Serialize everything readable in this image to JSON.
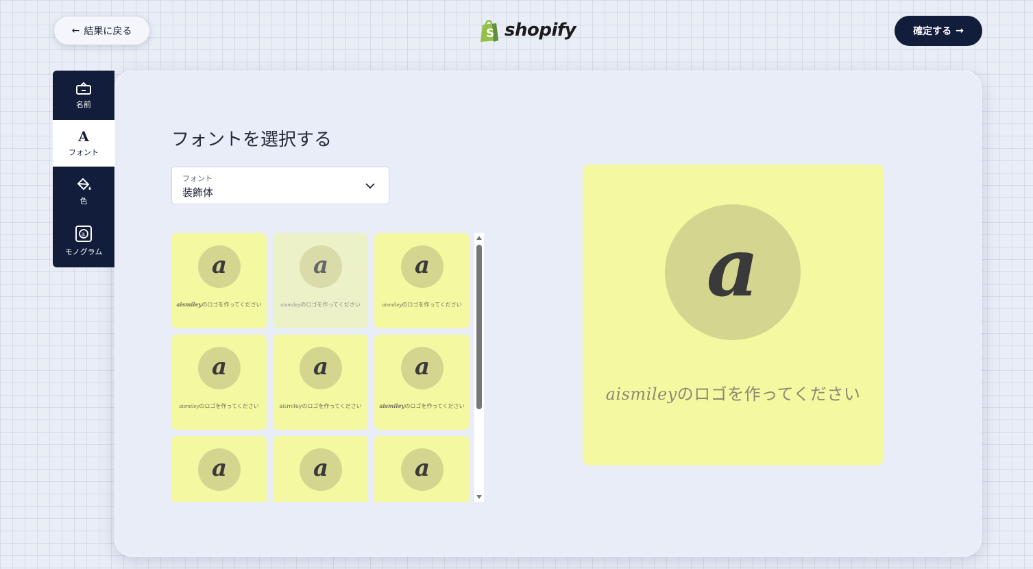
{
  "header": {
    "back_label": "結果に戻る",
    "confirm_label": "確定する",
    "brand": "shopify"
  },
  "sidebar": {
    "items": [
      {
        "label": "名前",
        "icon": "name-tag-icon"
      },
      {
        "label": "フォント",
        "icon": "font-icon",
        "glyph": "A"
      },
      {
        "label": "色",
        "icon": "paint-bucket-icon"
      },
      {
        "label": "モノグラム",
        "icon": "monogram-icon"
      }
    ],
    "active_index": 1
  },
  "main": {
    "title": "フォントを選択する",
    "font_select": {
      "label": "フォント",
      "value": "装飾体"
    },
    "tiles": [
      {
        "letter": "a",
        "brand": "aismiley",
        "caption": "のロゴを作ってください"
      },
      {
        "letter": "a",
        "brand": "aismiley",
        "caption": "のロゴを作ってください"
      },
      {
        "letter": "a",
        "brand": "aismiley",
        "caption": "のロゴを作ってください"
      },
      {
        "letter": "a",
        "brand": "aismiley",
        "caption": "のロゴを作ってください"
      },
      {
        "letter": "a",
        "brand": "aismiley",
        "caption": "のロゴを作ってください"
      },
      {
        "letter": "a",
        "brand": "aismiley",
        "caption": "のロゴを作ってください"
      },
      {
        "letter": "a",
        "brand": "",
        "caption": ""
      },
      {
        "letter": "a",
        "brand": "",
        "caption": ""
      },
      {
        "letter": "a",
        "brand": "",
        "caption": ""
      }
    ]
  },
  "preview": {
    "letter": "a",
    "brand": "aismiley",
    "caption": "のロゴを作ってください"
  },
  "colors": {
    "navy": "#121c3b",
    "tile_bg": "#f4f8a0",
    "circle_bg": "#d4d58f",
    "shopify_green": "#95bf47"
  }
}
